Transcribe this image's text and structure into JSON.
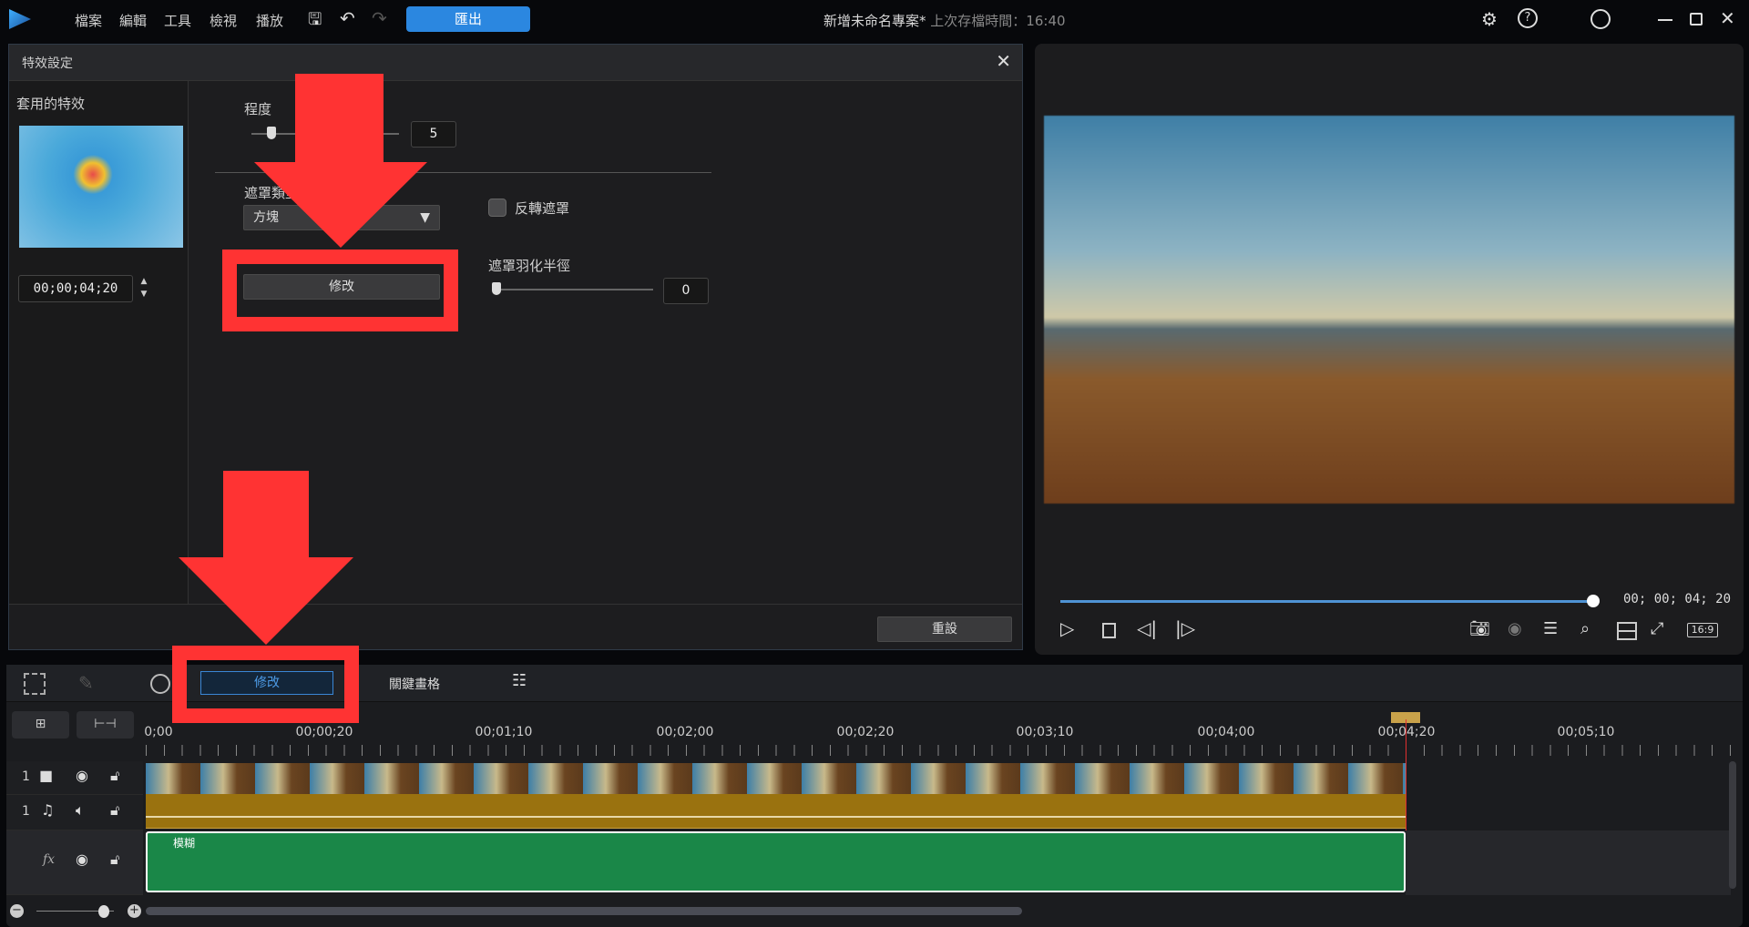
{
  "menu": {
    "items": [
      "檔案",
      "編輯",
      "工具",
      "檢視",
      "播放"
    ],
    "export": "匯出"
  },
  "title": {
    "project": "新增未命名專案*",
    "saved": "上次存檔時間：16:40"
  },
  "dialog": {
    "title": "特效設定",
    "applied_label": "套用的特效",
    "timecode": "00;00;04;20",
    "degree_label": "程度",
    "degree_value": "5",
    "degree_percent": 5,
    "mask_type_label": "遮罩類型",
    "mask_type_value": "方塊",
    "modify_button": "修改",
    "invert_mask": "反轉遮罩",
    "invert_checked": false,
    "feather_label": "遮罩羽化半徑",
    "feather_value": "0",
    "reset_button": "重設"
  },
  "player": {
    "timecode": "00; 00; 04; 20",
    "progress_percent": 100,
    "aspect": "16:9"
  },
  "timeline": {
    "modify_tab": "修改",
    "keyframe_tab": "關鍵畫格",
    "ruler": [
      "0;00",
      "00;00;20",
      "00;01;10",
      "00;02;00",
      "00;02;20",
      "00;03;10",
      "00;04;00",
      "00;04;20",
      "00;05;10"
    ],
    "track_video_num": "1",
    "track_audio_num": "1",
    "fx_label": "fx",
    "fx_clip": "模糊"
  },
  "colors": {
    "accent": "#2b87e0",
    "audio": "#9a720f",
    "fx": "#1a8748",
    "annotation": "#ff3333"
  }
}
